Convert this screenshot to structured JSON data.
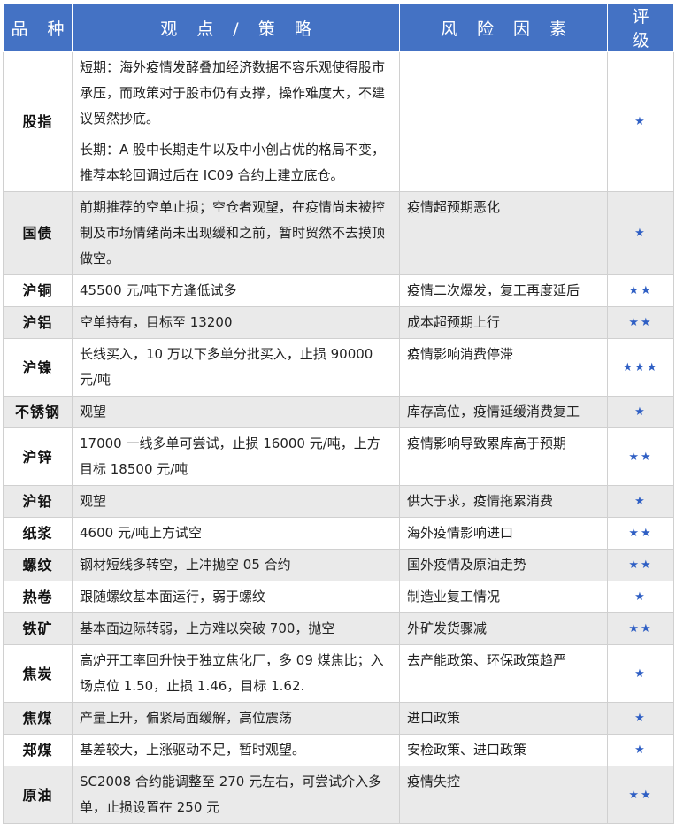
{
  "headers": [
    "品 种",
    "观 点 / 策 略",
    "风 险 因 素",
    "评 级"
  ],
  "rows": [
    {
      "name": "股指",
      "views": [
        "短期：海外疫情发酵叠加经济数据不容乐观使得股市承压，而政策对于股市仍有支撑，操作难度大，不建议贸然抄底。",
        "长期：A 股中长期走牛以及中小创占优的格局不变，推荐本轮回调过后在 IC09 合约上建立底仓。"
      ],
      "risk": "",
      "rating": "★"
    },
    {
      "name": "国债",
      "views": [
        "前期推荐的空单止损；空仓者观望，在疫情尚未被控制及市场情绪尚未出现缓和之前，暂时贸然不去摸顶做空。"
      ],
      "risk": "疫情超预期恶化",
      "rating": "★"
    },
    {
      "name": "沪铜",
      "views": [
        "45500 元/吨下方逢低试多"
      ],
      "risk": "疫情二次爆发，复工再度延后",
      "rating": "★★"
    },
    {
      "name": "沪铝",
      "views": [
        "空单持有，目标至 13200"
      ],
      "risk": "成本超预期上行",
      "rating": "★★"
    },
    {
      "name": "沪镍",
      "views": [
        "长线买入，10 万以下多单分批买入，止损 90000 元/吨"
      ],
      "risk": "疫情影响消费停滞",
      "rating": "★★★"
    },
    {
      "name": "不锈钢",
      "views": [
        "观望"
      ],
      "risk": "库存高位，疫情延缓消费复工",
      "rating": "★"
    },
    {
      "name": "沪锌",
      "views": [
        "17000 一线多单可尝试，止损 16000 元/吨，上方目标 18500 元/吨"
      ],
      "risk": "疫情影响导致累库高于预期",
      "rating": "★★"
    },
    {
      "name": "沪铅",
      "views": [
        "观望"
      ],
      "risk": "供大于求，疫情拖累消费",
      "rating": "★"
    },
    {
      "name": "纸浆",
      "views": [
        "4600 元/吨上方试空"
      ],
      "risk": "海外疫情影响进口",
      "rating": "★★"
    },
    {
      "name": "螺纹",
      "views": [
        "钢材短线多转空，上冲抛空 05 合约"
      ],
      "risk": "国外疫情及原油走势",
      "rating": "★★"
    },
    {
      "name": "热卷",
      "views": [
        "跟随螺纹基本面运行，弱于螺纹"
      ],
      "risk": "制造业复工情况",
      "rating": "★"
    },
    {
      "name": "铁矿",
      "views": [
        "基本面边际转弱，上方难以突破 700，抛空"
      ],
      "risk": "外矿发货骤减",
      "rating": "★★"
    },
    {
      "name": "焦炭",
      "views": [
        "高炉开工率回升快于独立焦化厂，多 09 煤焦比；入场点位 1.50，止损 1.46，目标 1.62."
      ],
      "risk": "去产能政策、环保政策趋严",
      "rating": "★"
    },
    {
      "name": "焦煤",
      "views": [
        "产量上升，偏紧局面缓解，高位震荡"
      ],
      "risk": "进口政策",
      "rating": "★"
    },
    {
      "name": "郑煤",
      "views": [
        "基差较大，上涨驱动不足，暂时观望。"
      ],
      "risk": "安检政策、进口政策",
      "rating": "★"
    },
    {
      "name": "原油",
      "views": [
        "SC2008 合约能调整至 270 元左右，可尝试介入多单，止损设置在 250 元"
      ],
      "risk": "疫情失控",
      "rating": "★★"
    }
  ]
}
